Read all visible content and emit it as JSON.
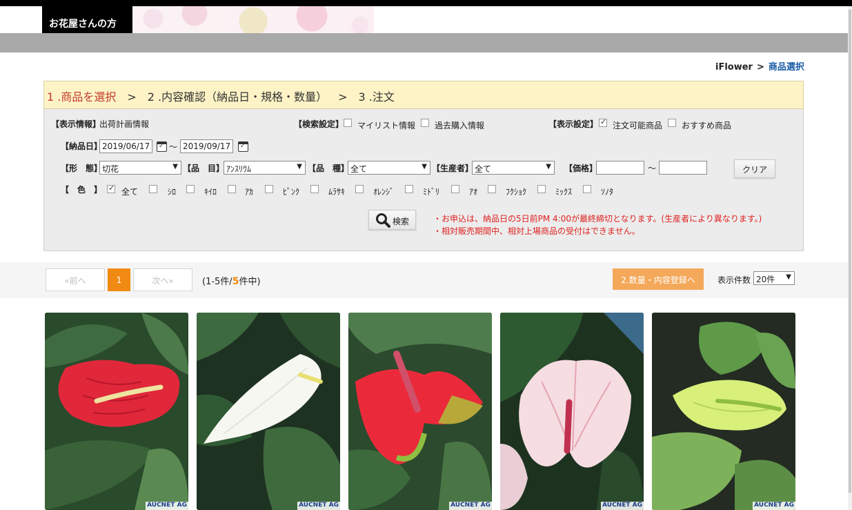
{
  "header": {
    "brand_tab": "お花屋さんの方"
  },
  "breadcrumb": {
    "root": "iFlower",
    "sep": ">",
    "current": "商品選択"
  },
  "steps": {
    "step1": "1 .商品を選択",
    "step2": "2 .内容確認（納品日・規格・数量）",
    "step3": "3 .注文",
    "arrow": ">"
  },
  "display_info": {
    "label": "【表示情報】",
    "value": "出荷計画情報"
  },
  "search_settings": {
    "label": "【検索設定】",
    "mylist": "マイリスト情報",
    "past": "過去購入情報"
  },
  "display_settings": {
    "label": "【表示設定】",
    "orderable": "注文可能商品",
    "recommended": "おすすめ商品"
  },
  "delivery": {
    "label": "【納品日】",
    "from": "2019/06/17",
    "tilde": "～",
    "to": "2019/09/17"
  },
  "form": {
    "label": "【形　態】",
    "value": "切花"
  },
  "item": {
    "label": "【品　目】",
    "value": "ｱﾝｽﾘｳﾑ"
  },
  "variety": {
    "label": "【品　種】",
    "value": "全て"
  },
  "producer": {
    "label": "【生産者】",
    "value": "全て"
  },
  "price": {
    "label": "【価格】",
    "tilde": "～"
  },
  "clear_button": "クリア",
  "color": {
    "label": "【　色　】",
    "options": [
      "全て",
      "ｼﾛ",
      "ｷｲﾛ",
      "ｱｶ",
      "ﾋﾟﾝｸ",
      "ﾑﾗｻｷ",
      "ｵﾚﾝｼﾞ",
      "ﾐﾄﾞﾘ",
      "ｱｵ",
      "ﾌｸｼｮｸ",
      "ﾐｯｸｽ",
      "ｿﾉﾀ"
    ]
  },
  "search_button": "検索",
  "notes": {
    "line1": "・お申込は、納品日の5日前PM 4:00が最終締切となります。(生産者により異なります。)",
    "line2": "・相対販売期間中、相対上場商品の受付はできません。"
  },
  "pager": {
    "prev": "«前へ",
    "page": "1",
    "next": "次へ»",
    "count_prefix": "(1-5件/",
    "count_total": "5",
    "count_suffix": "件中)"
  },
  "next_step_button": "2.数量・内容登録へ",
  "per_page": {
    "label": "表示件数",
    "value": "20件"
  },
  "products": [
    {
      "color_name": "red",
      "spathe": "#e0283a",
      "spadix": "#efe3a0",
      "watermark": "AUCNET AG"
    },
    {
      "color_name": "white",
      "spathe": "#f7f7f2",
      "spadix": "#e8e070",
      "watermark": "AUCNET AG"
    },
    {
      "color_name": "red-green",
      "spathe": "#ea2a3a",
      "spadix": "#d0506a",
      "watermark": "AUCNET AG"
    },
    {
      "color_name": "pink-white",
      "spathe": "#f6dde2",
      "spadix": "#c03050",
      "watermark": "AUCNET AG"
    },
    {
      "color_name": "lime",
      "spathe": "#d8ef7a",
      "spadix": "#8fbf40",
      "watermark": "AUCNET AG"
    }
  ],
  "colors": {
    "accent": "#f08a12",
    "step_active": "#c0392b",
    "notes": "#e02020",
    "link": "#1a5aa6"
  }
}
